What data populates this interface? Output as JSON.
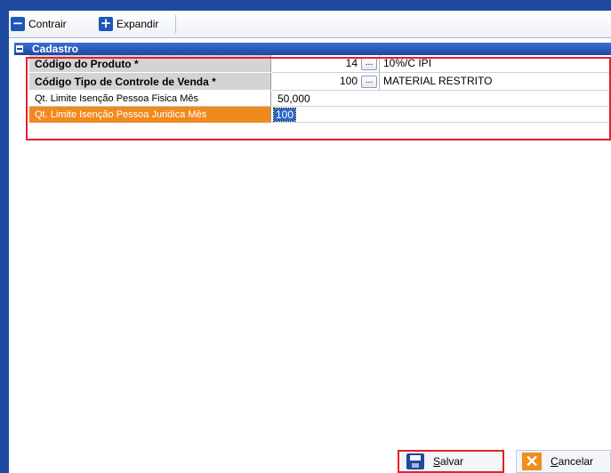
{
  "toolbar": {
    "collapse_label": "Contrair",
    "expand_label": "Expandir"
  },
  "section": {
    "title": "Cadastro"
  },
  "fields": {
    "product_code": {
      "label": "Código do Produto *",
      "value": "14",
      "lookup": "...",
      "description": "10%/C IPI"
    },
    "sale_control_type": {
      "label": "Código Tipo de Controle de Venda *",
      "value": "100",
      "lookup": "...",
      "description": "MATERIAL RESTRITO"
    },
    "limit_individual": {
      "label": "Qt. Limite Isenção Pessoa Fisica Mês",
      "value": "50,000"
    },
    "limit_company": {
      "label": "Qt. Limite Isenção Pessoa Juridica Mês",
      "value": "100"
    }
  },
  "buttons": {
    "save_first": "S",
    "save_rest": "alvar",
    "cancel_first": "C",
    "cancel_rest": "ancelar"
  },
  "colors": {
    "accent": "#1d4a9e",
    "selection": "#f08a1f",
    "highlight": "#e4202a"
  },
  "icons": {
    "collapse": "minus-icon",
    "expand": "plus-icon",
    "save": "floppy-disk-icon",
    "cancel": "x-icon"
  }
}
